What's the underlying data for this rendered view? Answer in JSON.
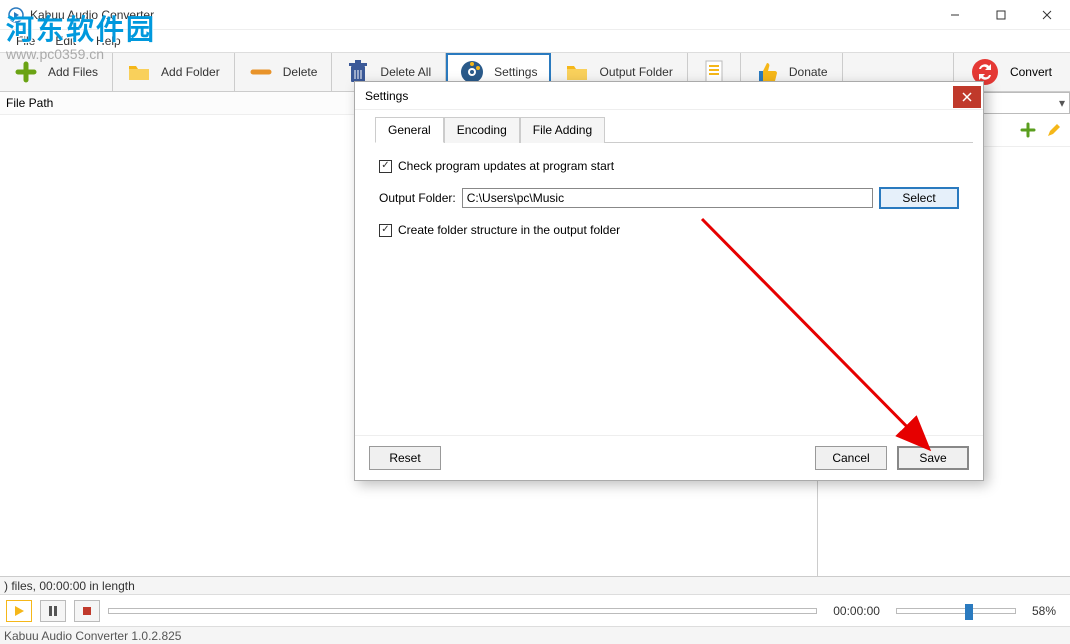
{
  "window": {
    "title": "Kabuu Audio Converter"
  },
  "menu": {
    "file": "File",
    "edit": "Edit",
    "help": "Help"
  },
  "toolbar": {
    "add_files": "Add Files",
    "add_folder": "Add Folder",
    "delete": "Delete",
    "delete_all": "Delete All",
    "settings": "Settings",
    "output_folder": "Output Folder",
    "donate": "Donate",
    "convert": "Convert"
  },
  "filelist": {
    "header": "File Path"
  },
  "status": {
    "files": ") files, 00:00:00 in length"
  },
  "transport": {
    "time": "00:00:00",
    "volume_pct": "58%"
  },
  "footer": {
    "version": "Kabuu Audio Converter 1.0.2.825"
  },
  "dialog": {
    "title": "Settings",
    "tabs": {
      "general": "General",
      "encoding": "Encoding",
      "file_adding": "File Adding"
    },
    "general": {
      "check_updates": "Check program updates at program start",
      "output_folder_label": "Output Folder:",
      "output_folder_value": "C:\\Users\\pc\\Music",
      "select": "Select",
      "create_structure": "Create folder structure in the output folder"
    },
    "buttons": {
      "reset": "Reset",
      "cancel": "Cancel",
      "save": "Save"
    }
  },
  "watermark": {
    "line1": "河东软件园",
    "line2": "www.pc0359.cn"
  }
}
